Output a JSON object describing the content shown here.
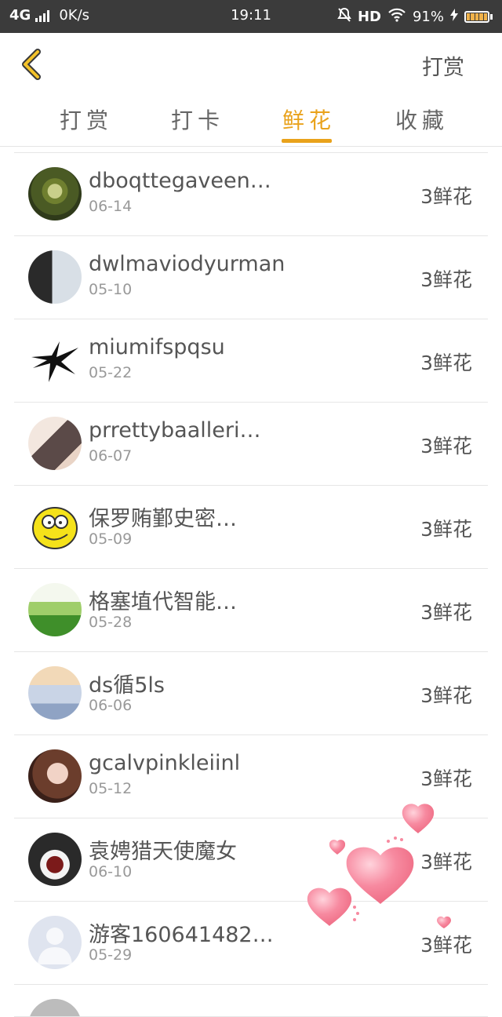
{
  "status_bar": {
    "network": "4G",
    "speed": "0K/s",
    "time": "19:11",
    "hd": "HD",
    "battery": "91%"
  },
  "header": {
    "back_icon": "chevron-left-icon",
    "action_label": "打赏",
    "accent_color": "#e9a21b"
  },
  "tabs": [
    {
      "label": "打赏",
      "active": false
    },
    {
      "label": "打卡",
      "active": false
    },
    {
      "label": "鲜花",
      "active": true
    },
    {
      "label": "收藏",
      "active": false
    }
  ],
  "list": {
    "items": [
      {
        "name": "dboqttegaveen…",
        "date": "06-14",
        "amount": "3鲜花",
        "avatar": "plant"
      },
      {
        "name": "dwlmaviodyurman",
        "date": "05-10",
        "amount": "3鲜花",
        "avatar": "girl-dark"
      },
      {
        "name": "miumifspqsu",
        "date": "05-22",
        "amount": "3鲜花",
        "avatar": "tribal"
      },
      {
        "name": "prrettybaalleri…",
        "date": "06-07",
        "amount": "3鲜花",
        "avatar": "girl-light"
      },
      {
        "name": "保罗贿鄞史密…",
        "date": "05-09",
        "amount": "3鲜花",
        "avatar": "cartoon"
      },
      {
        "name": "格塞埴代智能…",
        "date": "05-28",
        "amount": "3鲜花",
        "avatar": "meadow"
      },
      {
        "name": "ds循5ls",
        "date": "06-06",
        "amount": "3鲜花",
        "avatar": "sky"
      },
      {
        "name": "gcalvpinkleiinl",
        "date": "05-12",
        "amount": "3鲜花",
        "avatar": "portrait"
      },
      {
        "name": "袁娉猎天使魔女",
        "date": "06-10",
        "amount": "3鲜花",
        "avatar": "cupcakes"
      },
      {
        "name": "游客160641482…",
        "date": "05-29",
        "amount": "3鲜花",
        "avatar": "default-user"
      }
    ]
  }
}
